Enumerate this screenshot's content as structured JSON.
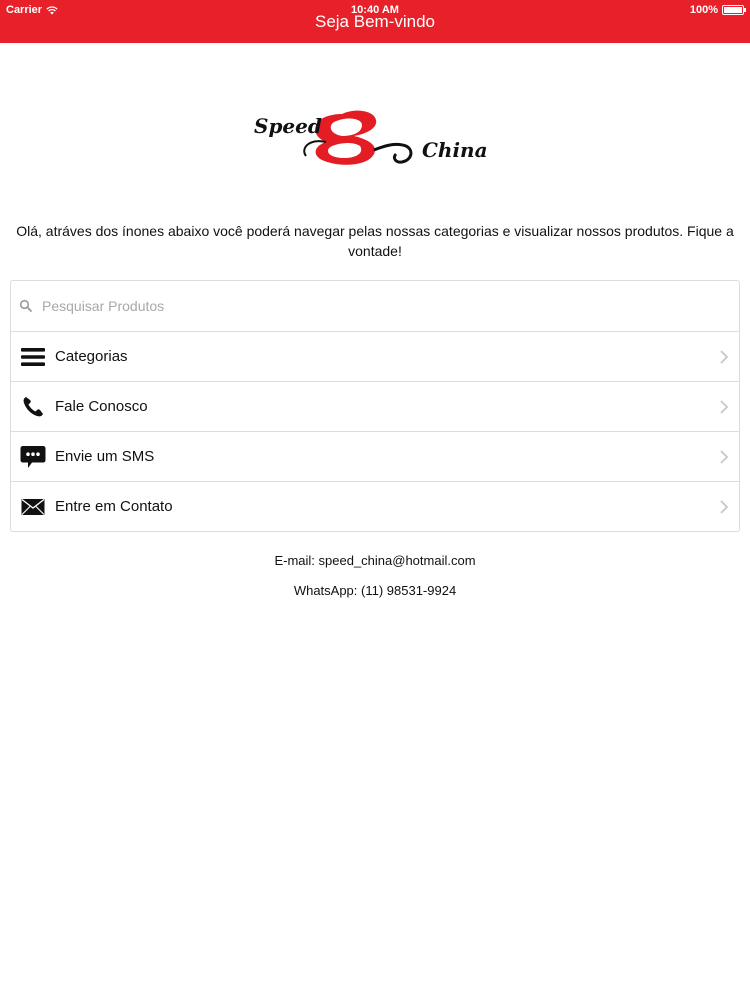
{
  "status_bar": {
    "carrier": "Carrier",
    "time": "10:40 AM",
    "battery": "100%"
  },
  "nav": {
    "title": "Seja Bem-vindo"
  },
  "logo": {
    "word1": "Speed",
    "word2": "China",
    "symbol": "&"
  },
  "intro": {
    "text": "Olá, atráves dos ínones abaixo você poderá navegar pelas nossas categorias e visualizar nossos produtos. Fique a vontade!"
  },
  "search": {
    "placeholder": "Pesquisar Produtos",
    "value": ""
  },
  "menu": {
    "items": [
      {
        "label": "Categorias",
        "icon": "list-icon"
      },
      {
        "label": "Fale Conosco",
        "icon": "phone-icon"
      },
      {
        "label": "Envie um SMS",
        "icon": "chat-bubble-icon"
      },
      {
        "label": "Entre em Contato",
        "icon": "envelope-icon"
      }
    ]
  },
  "contact": {
    "email": "E-mail: speed_china@hotmail.com",
    "whatsapp": "WhatsApp: (11) 98531-9924"
  },
  "colors": {
    "brand_red": "#e8202a",
    "logo_red": "#e41c24"
  }
}
